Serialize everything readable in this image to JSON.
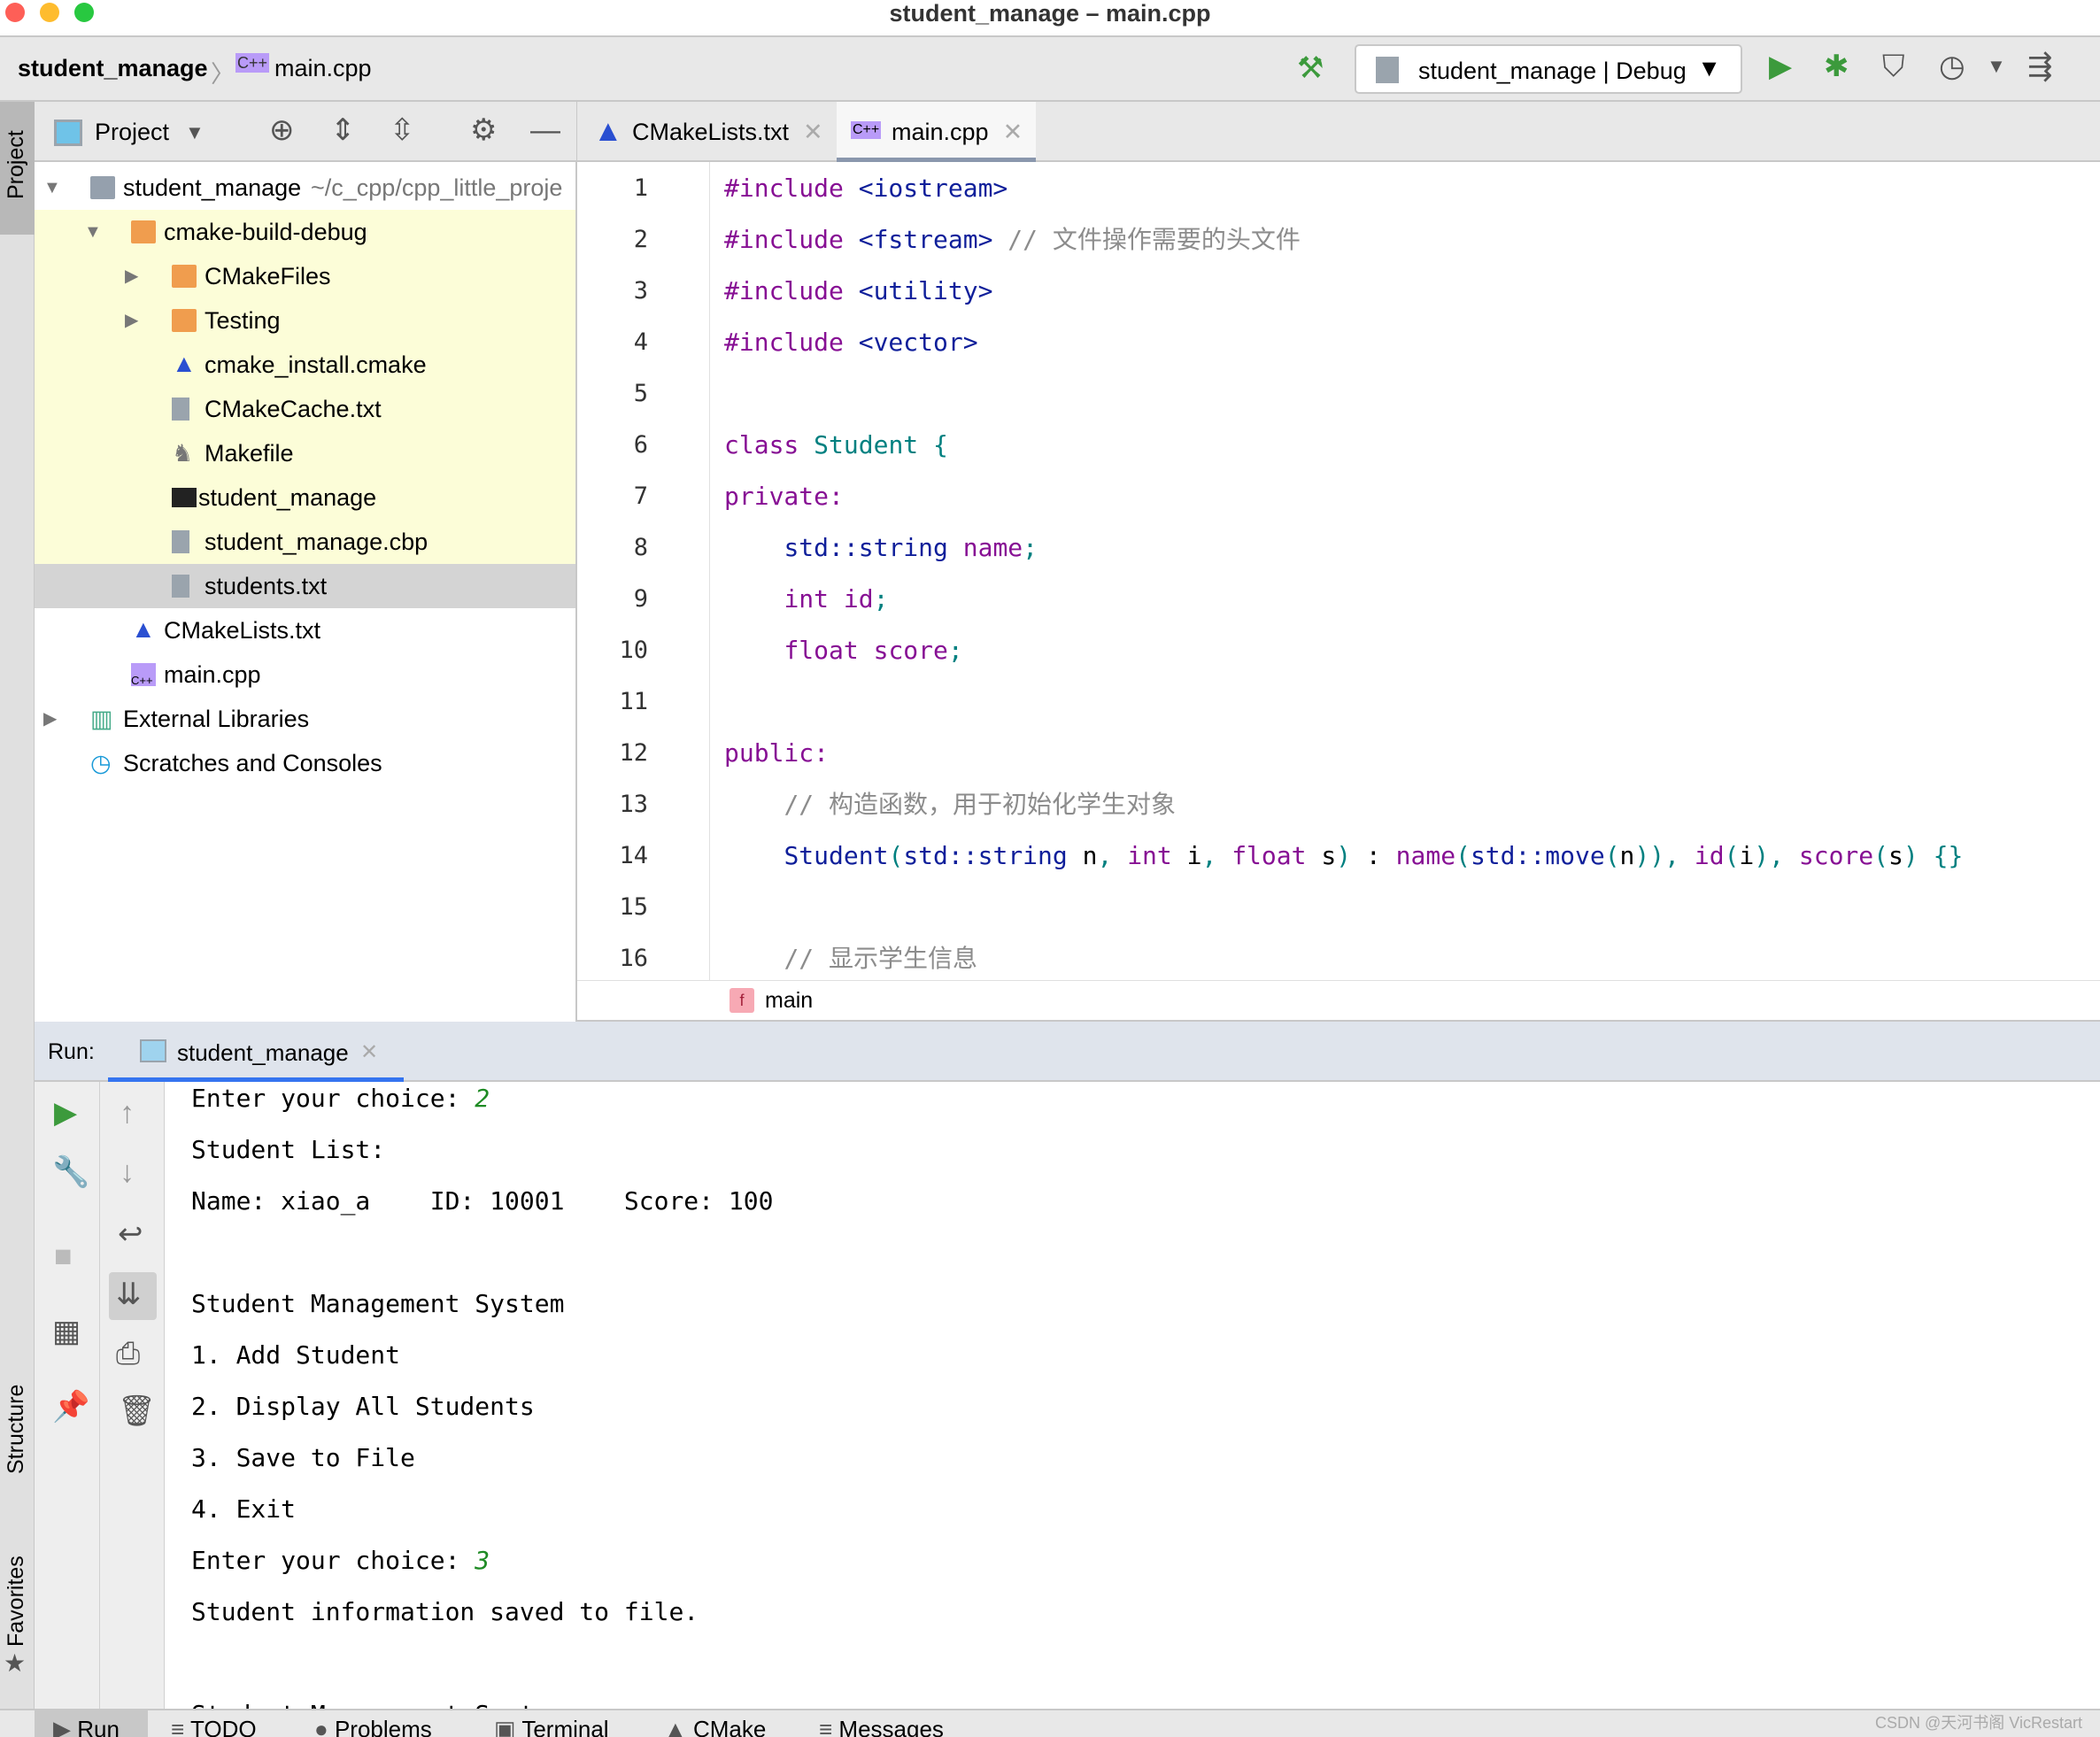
{
  "window": {
    "title": "student_manage – main.cpp"
  },
  "toolbar": {
    "project": "student_manage",
    "file": "main.cpp",
    "run_config": "student_manage | Debug"
  },
  "left_stripe": {
    "project": "Project",
    "structure": "Structure",
    "favorites": "Favorites"
  },
  "project_panel": {
    "title": "Project",
    "tree": [
      {
        "label": "student_manage",
        "path": "~/c_cpp/cpp_little_proje",
        "icon": "module-folder"
      },
      {
        "label": "cmake-build-debug",
        "icon": "folder"
      },
      {
        "label": "CMakeFiles",
        "icon": "folder"
      },
      {
        "label": "Testing",
        "icon": "folder"
      },
      {
        "label": "cmake_install.cmake",
        "icon": "cmake"
      },
      {
        "label": "CMakeCache.txt",
        "icon": "cmake-cache"
      },
      {
        "label": "Makefile",
        "icon": "makefile"
      },
      {
        "label": "student_manage",
        "icon": "executable"
      },
      {
        "label": "student_manage.cbp",
        "icon": "text-file"
      },
      {
        "label": "students.txt",
        "icon": "text-file"
      },
      {
        "label": "CMakeLists.txt",
        "icon": "cmake"
      },
      {
        "label": "main.cpp",
        "icon": "cpp-file"
      },
      {
        "label": "External Libraries",
        "icon": "libraries"
      },
      {
        "label": "Scratches and Consoles",
        "icon": "scratches"
      }
    ]
  },
  "editor": {
    "tabs": [
      {
        "label": "CMakeLists.txt"
      },
      {
        "label": "main.cpp",
        "active": true
      }
    ],
    "line_numbers": [
      "1",
      "2",
      "3",
      "4",
      "5",
      "6",
      "7",
      "8",
      "9",
      "10",
      "11",
      "12",
      "13",
      "14",
      "15",
      "16"
    ],
    "breadcrumb": "main"
  },
  "run": {
    "label": "Run:",
    "tab": "student_manage",
    "lines": [
      {
        "text": "Enter your choice: ",
        "input": "2"
      },
      {
        "text": "Student List:"
      },
      {
        "text": "Name: xiao_a    ID: 10001    Score: 100"
      },
      {
        "text": ""
      },
      {
        "text": "Student Management System"
      },
      {
        "text": "1. Add Student"
      },
      {
        "text": "2. Display All Students"
      },
      {
        "text": "3. Save to File"
      },
      {
        "text": "4. Exit"
      },
      {
        "text": "Enter your choice: ",
        "input": "3"
      },
      {
        "text": "Student information saved to file."
      },
      {
        "text": ""
      },
      {
        "text": "Student Management System"
      }
    ]
  },
  "bottom_tabs": [
    "Run",
    "TODO",
    "Problems",
    "Terminal",
    "CMake",
    "Messages"
  ],
  "watermark": "CSDN @天河书阁 VicRestart",
  "colors": {
    "accent_green": "#3c9a3c",
    "tree_highlight": "#fcfdd8",
    "input_green": "#1f8b24"
  }
}
